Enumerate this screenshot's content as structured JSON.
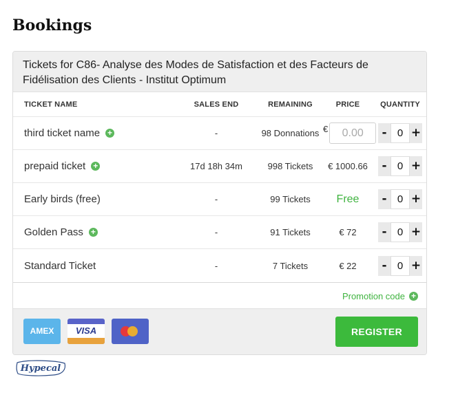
{
  "page": {
    "title": "Bookings"
  },
  "event": {
    "title": "Tickets for C86- Analyse des Modes de Satisfaction et des Facteurs de Fidélisation des Clients - Institut Optimum"
  },
  "table": {
    "headers": {
      "name": "TICKET NAME",
      "sales_end": "SALES END",
      "remaining": "REMAINING",
      "price": "PRICE",
      "quantity": "QUANTITY"
    },
    "rows": [
      {
        "name": "third ticket name",
        "has_info": true,
        "sales_end": "-",
        "remaining": "98 Donnations",
        "price_type": "input",
        "currency": "€",
        "price_placeholder": "0.00",
        "quantity": "0"
      },
      {
        "name": "prepaid ticket",
        "has_info": true,
        "sales_end": "17d 18h 34m",
        "remaining": "998 Tickets",
        "price": "€ 1000.66",
        "quantity": "0"
      },
      {
        "name": "Early birds (free)",
        "has_info": false,
        "sales_end": "-",
        "remaining": "99 Tickets",
        "price": "Free",
        "quantity": "0"
      },
      {
        "name": "Golden Pass",
        "has_info": true,
        "sales_end": "-",
        "remaining": "91 Tickets",
        "price": "€ 72",
        "quantity": "0"
      },
      {
        "name": "Standard Ticket",
        "has_info": false,
        "sales_end": "-",
        "remaining": "7 Tickets",
        "price": "€ 22",
        "quantity": "0"
      }
    ],
    "qty_minus": "-",
    "qty_plus": "+"
  },
  "promo": {
    "label": "Promotion code",
    "icon": "plus-circle-icon"
  },
  "payment": {
    "cards": [
      {
        "name": "amex",
        "label": "AMEX",
        "color": "#5bb5ea"
      },
      {
        "name": "visa",
        "label": "VISA",
        "color": "#5863c9"
      },
      {
        "name": "mastercard",
        "label": "",
        "color": "#4f63c7"
      }
    ]
  },
  "register": {
    "label": "REGISTER",
    "color": "#3cba3c"
  },
  "brand": {
    "name": "Hypecal"
  },
  "colors": {
    "accent_green": "#3fb33f",
    "panel_bg": "#efefef"
  }
}
